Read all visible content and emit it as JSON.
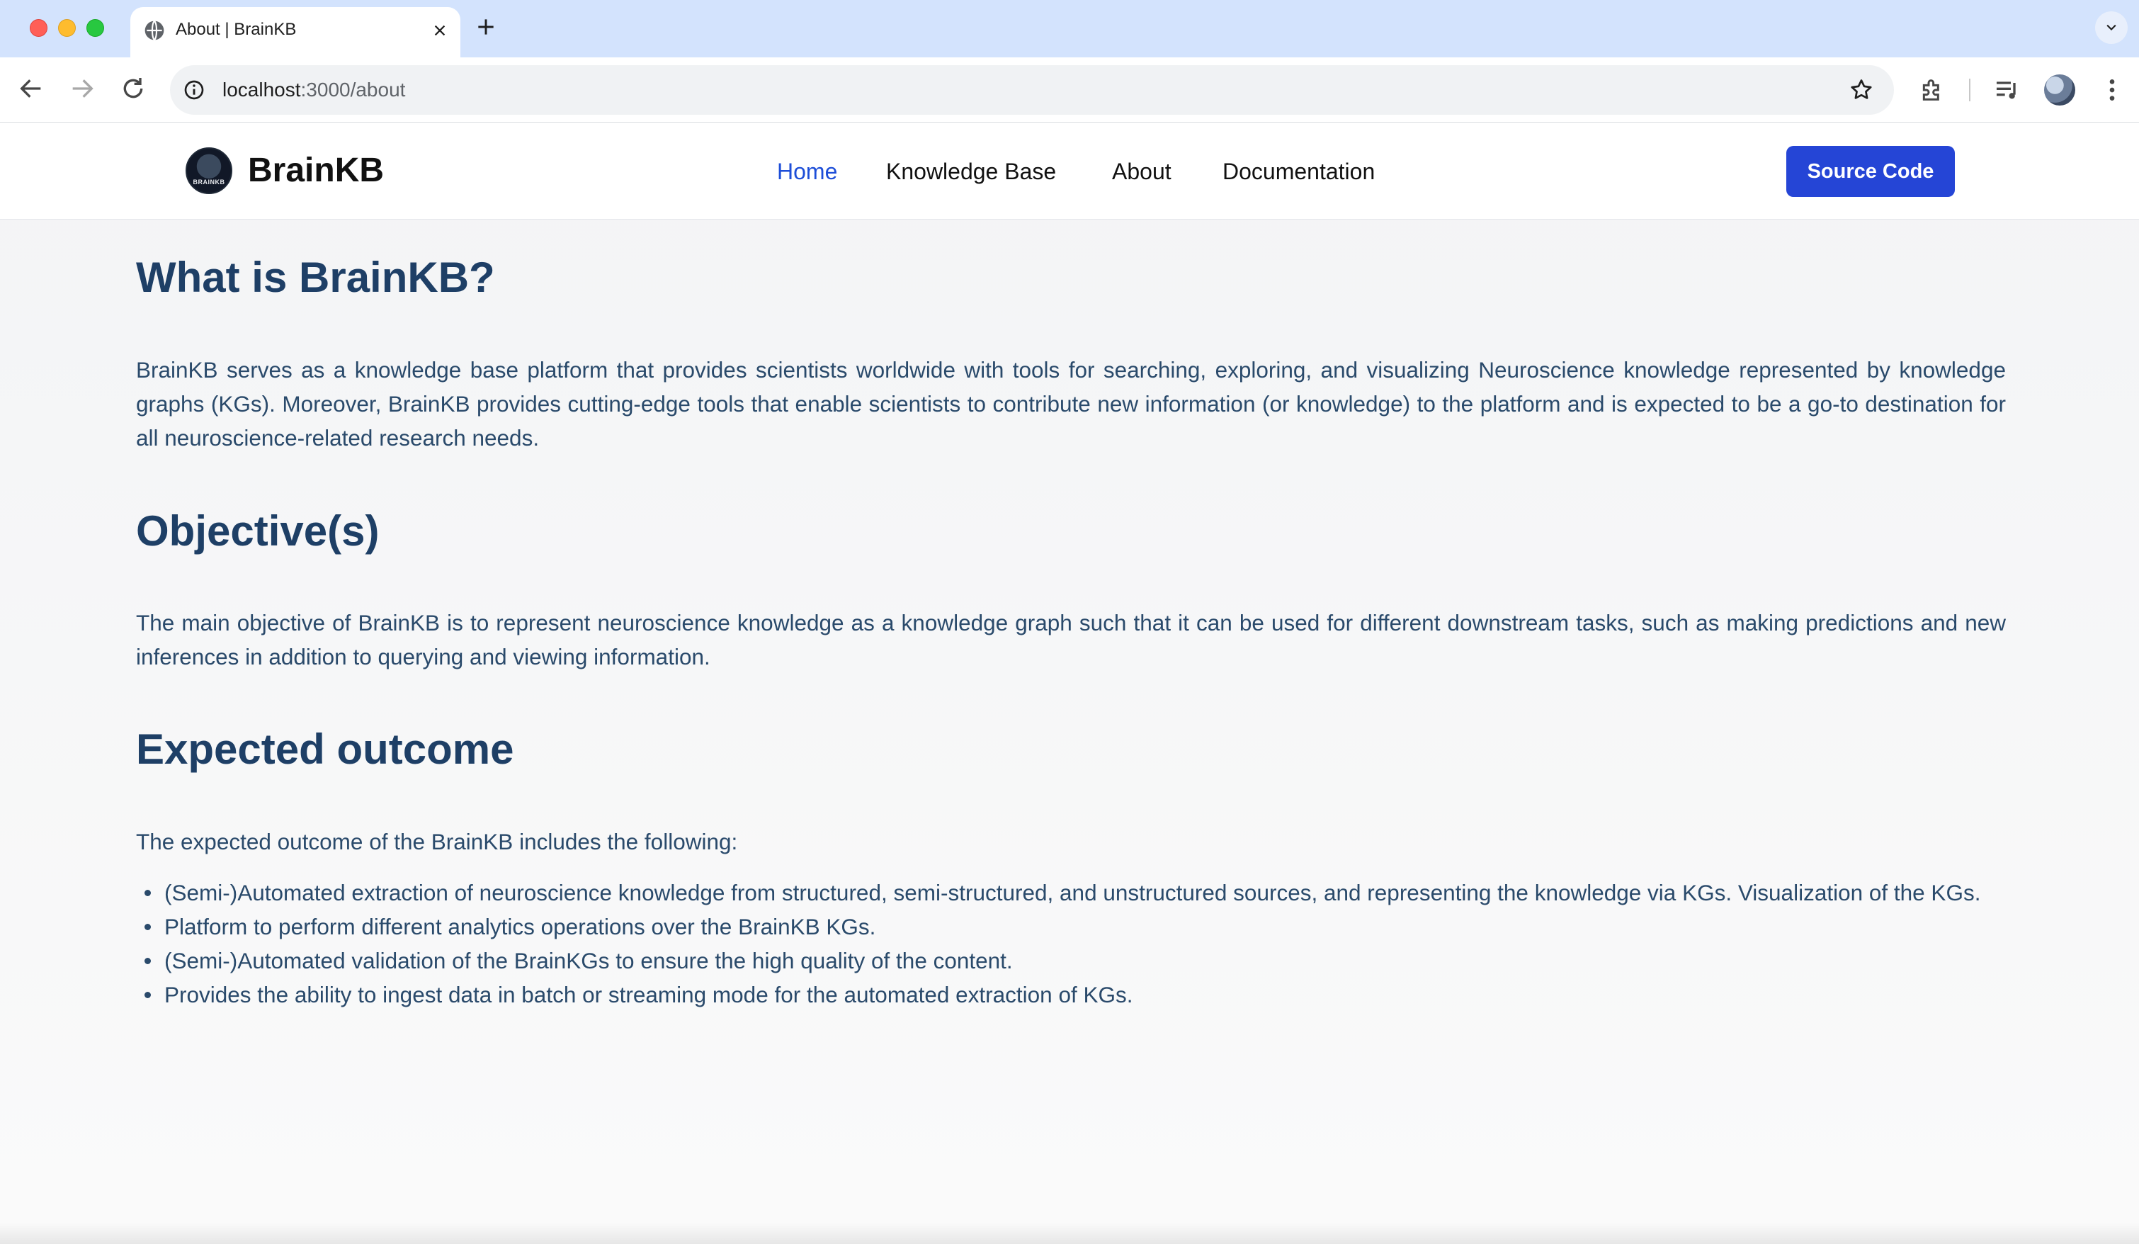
{
  "browser": {
    "tab_title": "About | BrainKB",
    "url_host": "localhost",
    "url_path": ":3000/about"
  },
  "site": {
    "brand": "BrainKB",
    "logo_text": "BRAINKB",
    "nav": {
      "home": "Home",
      "knowledge_base": "Knowledge Base",
      "about": "About",
      "documentation": "Documentation"
    },
    "source_button": "Source Code",
    "active_nav": "Home",
    "accent_color": "#2545d6"
  },
  "content": {
    "what": {
      "heading": "What is BrainKB?",
      "text": "BrainKB serves as a knowledge base platform that provides scientists worldwide with tools for searching, exploring, and visualizing Neuroscience knowledge represented by knowledge graphs (KGs). Moreover, BrainKB provides cutting-edge tools that enable scientists to contribute new information (or knowledge) to the platform and is expected to be a go-to destination for all neuroscience-related research needs."
    },
    "objective": {
      "heading": "Objective(s)",
      "text": "The main objective of BrainKB is to represent neuroscience knowledge as a knowledge graph such that it can be used for different downstream tasks, such as making predictions and new inferences in addition to querying and viewing information."
    },
    "outcome": {
      "heading": "Expected outcome",
      "intro": "The expected outcome of the BrainKB includes the following:",
      "items": [
        "(Semi-)Automated extraction of neuroscience knowledge from structured, semi-structured, and unstructured sources, and representing the knowledge via KGs. Visualization of the KGs.",
        "Platform to perform different analytics operations over the BrainKB KGs.",
        "(Semi-)Automated validation of the BrainKGs to ensure the high quality of the content.",
        "Provides the ability to ingest data in batch or streaming mode for the automated extraction of KGs."
      ]
    }
  }
}
